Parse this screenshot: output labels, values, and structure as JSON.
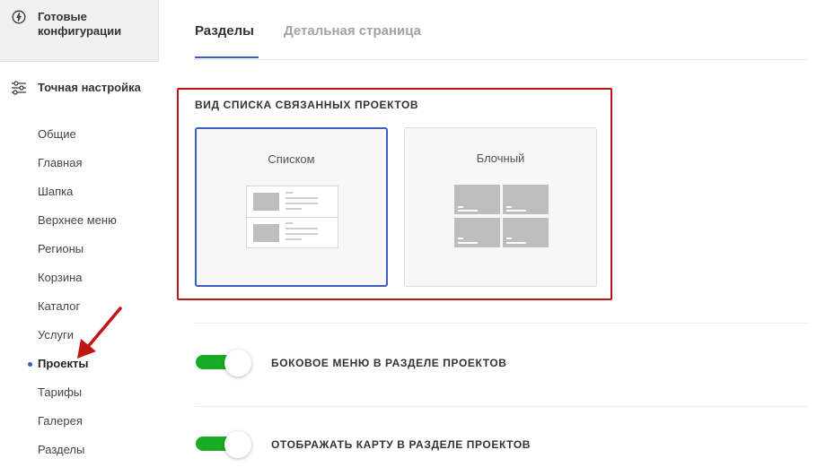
{
  "sidebar": {
    "ready_configs": "Готовые конфигурации",
    "fine_tuning": "Точная настройка",
    "items": [
      {
        "label": "Общие"
      },
      {
        "label": "Главная"
      },
      {
        "label": "Шапка"
      },
      {
        "label": "Верхнее меню"
      },
      {
        "label": "Регионы"
      },
      {
        "label": "Корзина"
      },
      {
        "label": "Каталог"
      },
      {
        "label": "Услуги"
      },
      {
        "label": "Проекты",
        "active": true
      },
      {
        "label": "Тарифы"
      },
      {
        "label": "Галерея"
      },
      {
        "label": "Разделы"
      }
    ]
  },
  "tabs": [
    {
      "label": "Разделы",
      "active": true
    },
    {
      "label": "Детальная страница",
      "active": false
    }
  ],
  "list_view": {
    "title": "ВИД СПИСКА СВЯЗАННЫХ ПРОЕКТОВ",
    "options": [
      {
        "label": "Списком",
        "selected": true
      },
      {
        "label": "Блочный",
        "selected": false
      }
    ]
  },
  "toggles": [
    {
      "label": "БОКОВОЕ МЕНЮ В РАЗДЕЛЕ ПРОЕКТОВ",
      "on": true
    },
    {
      "label": "ОТОБРАЖАТЬ КАРТУ В РАЗДЕЛЕ ПРОЕКТОВ",
      "on": true
    }
  ],
  "colors": {
    "accent": "#3a5cc4",
    "toggle_on": "#1aab24",
    "highlight": "#c01515"
  },
  "icons": {
    "ready_configs": "configuration-circle-icon",
    "fine_tuning": "sliders-icon",
    "annotation": "red-arrow-icon"
  }
}
